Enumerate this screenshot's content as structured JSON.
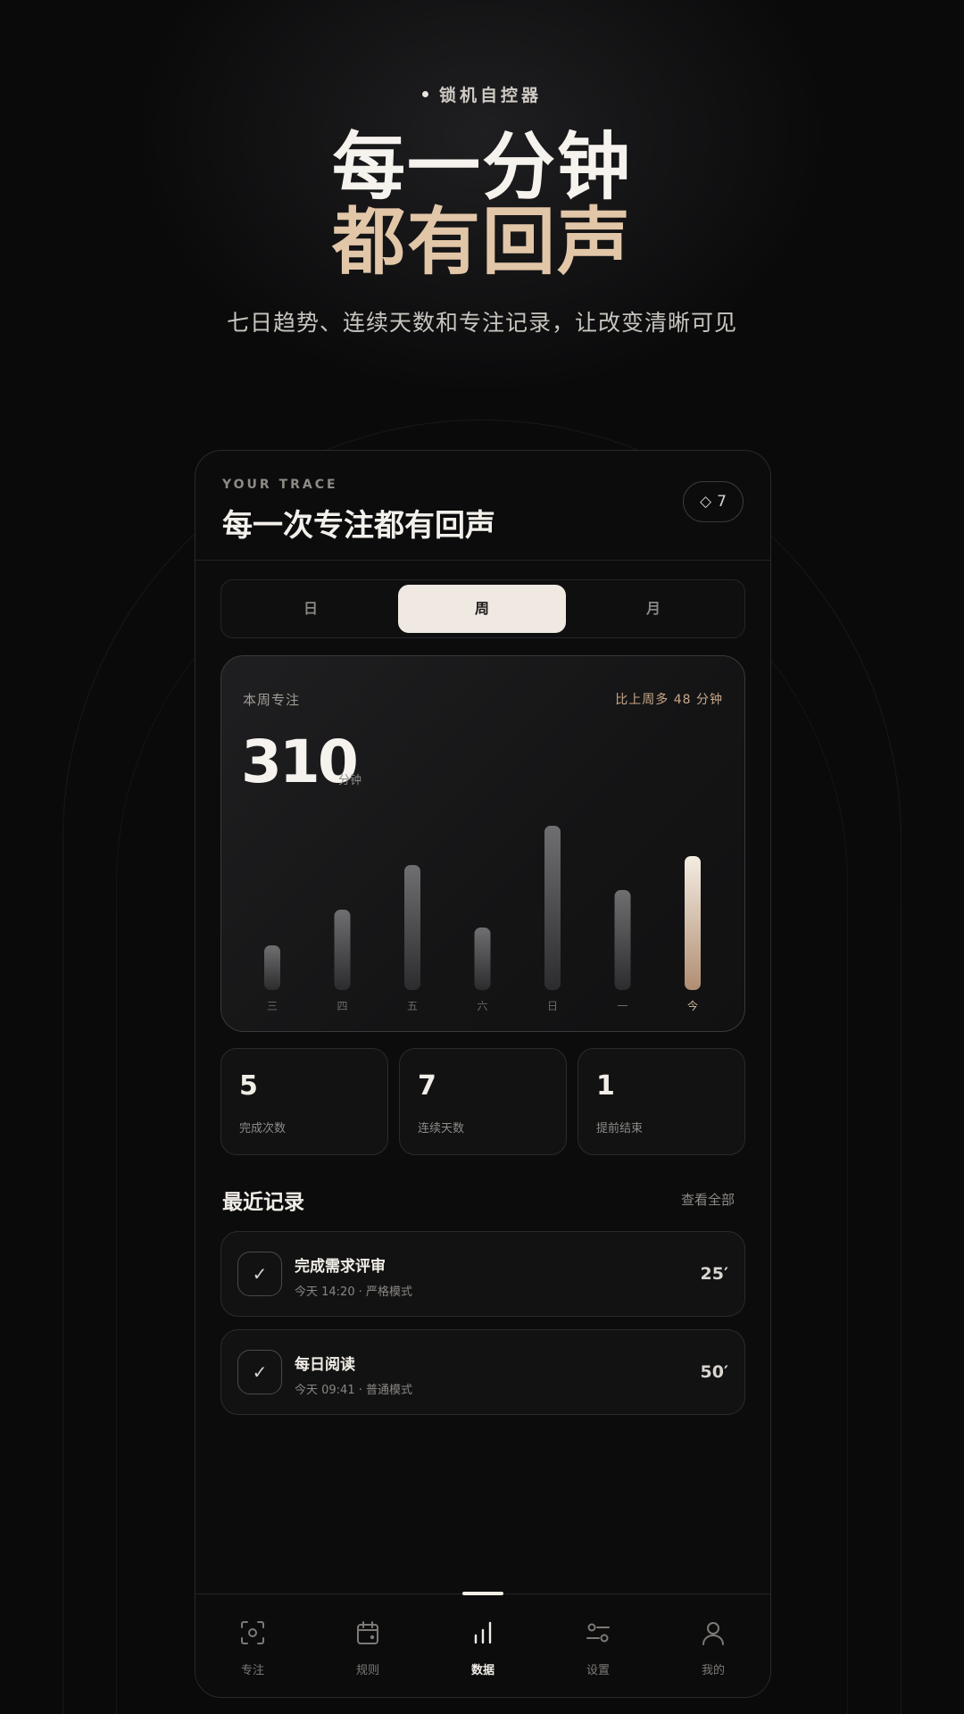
{
  "hero": {
    "tag": "锁机自控器",
    "title_line1": "每一分钟",
    "title_line2": "都有回声",
    "subtitle": "七日趋势、连续天数和专注记录，让改变清晰可见"
  },
  "header": {
    "eyebrow": "YOUR TRACE",
    "title": "每一次专注都有回声",
    "badge_value": "7",
    "badge_icon": "diamond-icon"
  },
  "segmented": {
    "items": [
      "日",
      "周",
      "月"
    ],
    "selected": "周"
  },
  "weekly": {
    "label": "本周专注",
    "compare": "比上周多 48 分钟",
    "total": "310",
    "unit": "分钟"
  },
  "chart_data": {
    "type": "bar",
    "categories": [
      "三",
      "四",
      "五",
      "六",
      "日",
      "一",
      "今"
    ],
    "values": [
      25,
      45,
      70,
      35,
      92,
      56,
      75
    ],
    "title": "",
    "xlabel": "",
    "ylabel": "",
    "ylim": [
      0,
      100
    ],
    "grid": false,
    "highlight_index": 6,
    "colors": {
      "bar_top": "#6f6f72",
      "bar_bottom": "#2c2c2e",
      "highlight_top": "#f4ece2",
      "highlight_bottom": "#b08e72"
    }
  },
  "stats": [
    {
      "value": "5",
      "label": "完成次数"
    },
    {
      "value": "7",
      "label": "连续天数"
    },
    {
      "value": "1",
      "label": "提前结束"
    }
  ],
  "records": {
    "title": "最近记录",
    "view_all": "查看全部",
    "items": [
      {
        "title": "完成需求评审",
        "subtitle": "今天 14:20 · 严格模式",
        "duration": "25′"
      },
      {
        "title": "每日阅读",
        "subtitle": "今天 09:41 · 普通模式",
        "duration": "50′"
      }
    ]
  },
  "tabbar": {
    "items": [
      {
        "label": "专注",
        "icon": "focus-scan-icon"
      },
      {
        "label": "规则",
        "icon": "calendar-icon"
      },
      {
        "label": "数据",
        "icon": "bar-chart-icon"
      },
      {
        "label": "设置",
        "icon": "sliders-icon"
      },
      {
        "label": "我的",
        "icon": "user-icon"
      }
    ],
    "active": "数据"
  },
  "colors": {
    "accent": "#e2c6a8",
    "background": "#0a0a0b"
  }
}
